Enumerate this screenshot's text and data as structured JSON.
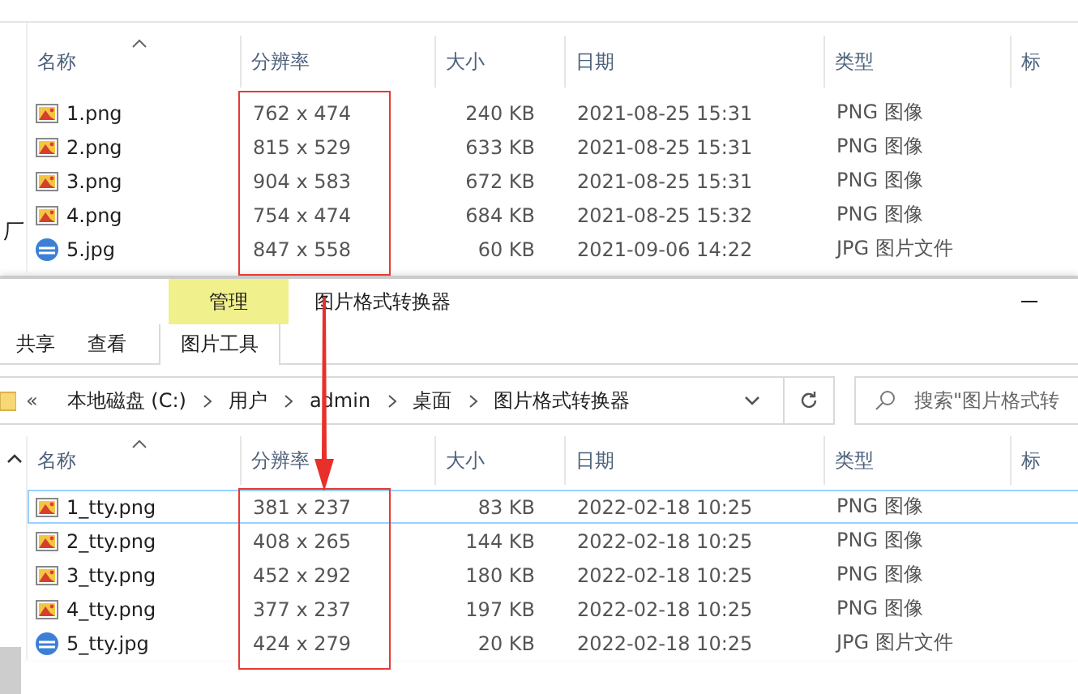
{
  "top_pane": {
    "sidebar_fragment": "厂",
    "sort_ascending": true,
    "resolution_highlighted": true,
    "columns": [
      "名称",
      "分辨率",
      "大小",
      "日期",
      "类型",
      "标"
    ],
    "rows": [
      {
        "kind": "png",
        "name": "1.png",
        "resolution": "762 x 474",
        "size": "240 KB",
        "date": "2021-08-25 15:31",
        "type": "PNG 图像",
        "selected": false
      },
      {
        "kind": "png",
        "name": "2.png",
        "resolution": "815 x 529",
        "size": "633 KB",
        "date": "2021-08-25 15:31",
        "type": "PNG 图像",
        "selected": false
      },
      {
        "kind": "png",
        "name": "3.png",
        "resolution": "904 x 583",
        "size": "672 KB",
        "date": "2021-08-25 15:31",
        "type": "PNG 图像",
        "selected": false
      },
      {
        "kind": "png",
        "name": "4.png",
        "resolution": "754 x 474",
        "size": "684 KB",
        "date": "2021-08-25 15:32",
        "type": "PNG 图像",
        "selected": false
      },
      {
        "kind": "jpg",
        "name": "5.jpg",
        "resolution": "847 x 558",
        "size": "60 KB",
        "date": "2021-09-06 14:22",
        "type": "JPG 图片文件",
        "selected": false
      }
    ]
  },
  "window": {
    "context_tab": "管理",
    "title": "图片格式转换器",
    "tabs": [
      {
        "label": "共享",
        "selected": false
      },
      {
        "label": "查看",
        "selected": false
      },
      {
        "label": "图片工具",
        "selected": true
      }
    ],
    "address": {
      "overflow": "«",
      "crumbs": [
        "本地磁盘 (C:)",
        "用户",
        "admin",
        "桌面",
        "图片格式转换器"
      ]
    },
    "search": {
      "placeholder": "搜索\"图片格式转"
    },
    "list": {
      "sort_ascending": true,
      "resolution_highlighted": true,
      "columns": [
        "名称",
        "分辨率",
        "大小",
        "日期",
        "类型",
        "标"
      ],
      "rows": [
        {
          "kind": "png",
          "name": "1_tty.png",
          "resolution": "381 x 237",
          "size": "83 KB",
          "date": "2022-02-18 10:25",
          "type": "PNG 图像",
          "selected": true
        },
        {
          "kind": "png",
          "name": "2_tty.png",
          "resolution": "408 x 265",
          "size": "144 KB",
          "date": "2022-02-18 10:25",
          "type": "PNG 图像",
          "selected": false
        },
        {
          "kind": "png",
          "name": "3_tty.png",
          "resolution": "452 x 292",
          "size": "180 KB",
          "date": "2022-02-18 10:25",
          "type": "PNG 图像",
          "selected": false
        },
        {
          "kind": "png",
          "name": "4_tty.png",
          "resolution": "377 x 237",
          "size": "197 KB",
          "date": "2022-02-18 10:25",
          "type": "PNG 图像",
          "selected": false
        },
        {
          "kind": "jpg",
          "name": "5_tty.jpg",
          "resolution": "424 x 279",
          "size": "20 KB",
          "date": "2022-02-18 10:25",
          "type": "JPG 图片文件",
          "selected": false
        }
      ]
    }
  },
  "annotation_arrow": true
}
